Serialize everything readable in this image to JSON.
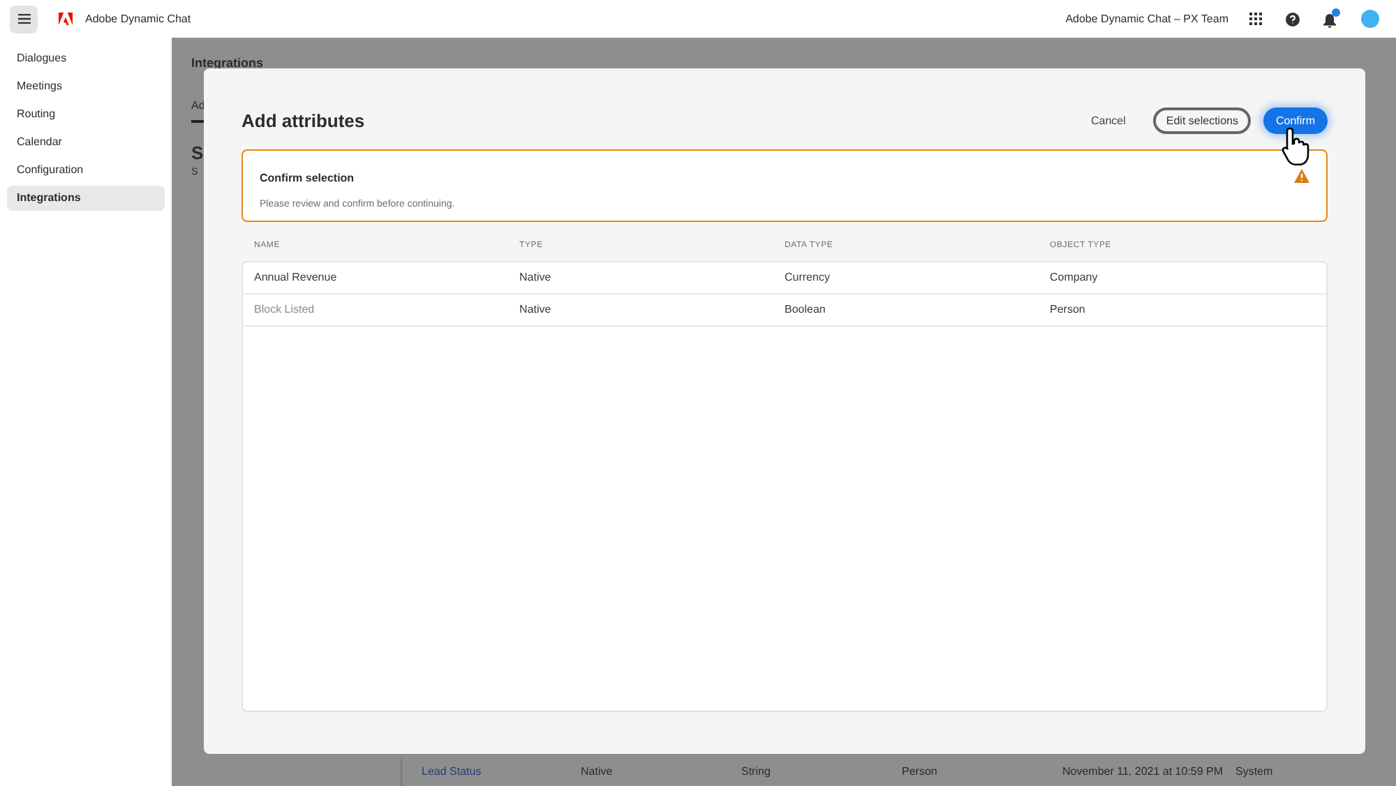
{
  "topbar": {
    "app_name": "Adobe Dynamic Chat",
    "org": "Adobe Dynamic Chat – PX Team",
    "has_notification": true
  },
  "sidebar": {
    "items": [
      {
        "label": "Dialogues",
        "selected": false
      },
      {
        "label": "Meetings",
        "selected": false
      },
      {
        "label": "Routing",
        "selected": false
      },
      {
        "label": "Calendar",
        "selected": false
      },
      {
        "label": "Configuration",
        "selected": false
      },
      {
        "label": "Integrations",
        "selected": true
      }
    ]
  },
  "background": {
    "title": "Integrations",
    "tab": "Ad",
    "heading": "S",
    "subtext": "S",
    "row": [
      "Lead Status",
      "Native",
      "String",
      "Person",
      "November 11, 2021 at 10:59 PM",
      "System"
    ]
  },
  "dialog": {
    "title": "Add attributes",
    "buttons": {
      "cancel": "Cancel",
      "edit": "Edit selections",
      "confirm": "Confirm"
    },
    "alert": {
      "title": "Confirm selection",
      "message": "Please review and confirm before continuing."
    },
    "table": {
      "columns": [
        "NAME",
        "TYPE",
        "DATA TYPE",
        "OBJECT TYPE"
      ],
      "rows": [
        {
          "cells": [
            "Annual Revenue",
            "Native",
            "Currency",
            "Company"
          ],
          "dimmed": false
        },
        {
          "cells": [
            "Block Listed",
            "Native",
            "Boolean",
            "Person"
          ],
          "dimmed": true
        }
      ]
    }
  }
}
